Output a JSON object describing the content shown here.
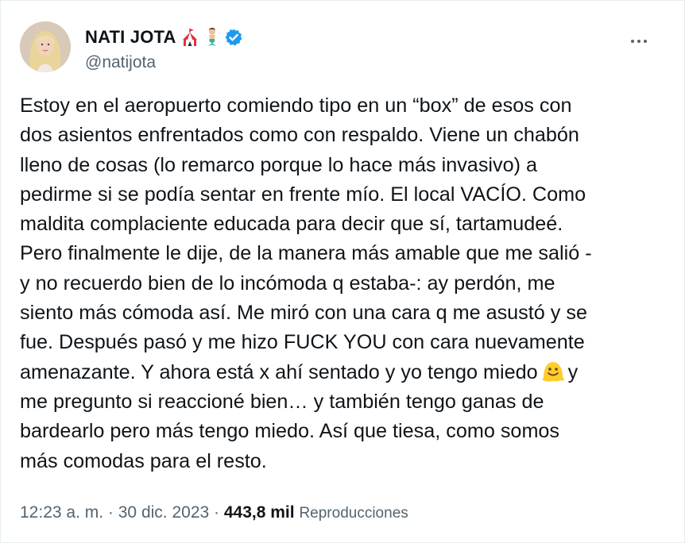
{
  "author": {
    "display_name": "NATI JOTA",
    "handle": "@natijota",
    "name_emojis": [
      "circus-tent-emoji",
      "mermaid-emoji"
    ],
    "verified": true
  },
  "tweet": {
    "lines": [
      "Estoy en el aeropuerto comiendo tipo en un “box” de esos con",
      "dos asientos enfrentados como con respaldo. Viene un chabón",
      "lleno de cosas (lo remarco porque lo hace más invasivo) a",
      "pedirme si se podía sentar en frente mío. El local VACÍO. Como",
      "maldita complaciente educada para decir que sí, tartamudeé.",
      "Pero finalmente le dije, de la manera más amable que me salió -",
      "y no recuerdo bien de lo incómoda q estaba-: ay perdón, me",
      "siento más cómoda así. Me miró con una cara q me asustó y se",
      "fue. Después pasó y me hizo FUCK YOU con cara nuevamente",
      "amenazante. Y ahora está x ahí sentado y yo tengo miedo",
      "y",
      "me pregunto si reaccioné bien… y también tengo ganas de",
      "bardearlo pero más tengo miedo. Así que tiesa, como somos",
      "más comodas para el resto."
    ],
    "inline_emoji": "melting-face-emoji"
  },
  "meta": {
    "time": "12:23 a. m.",
    "separator": "·",
    "date": "30 dic. 2023",
    "views_count": "443,8 mil",
    "views_label": "Reproducciones"
  },
  "colors": {
    "verified": "#1d9bf0",
    "secondary_text": "#536471",
    "primary_text": "#0f1419"
  }
}
